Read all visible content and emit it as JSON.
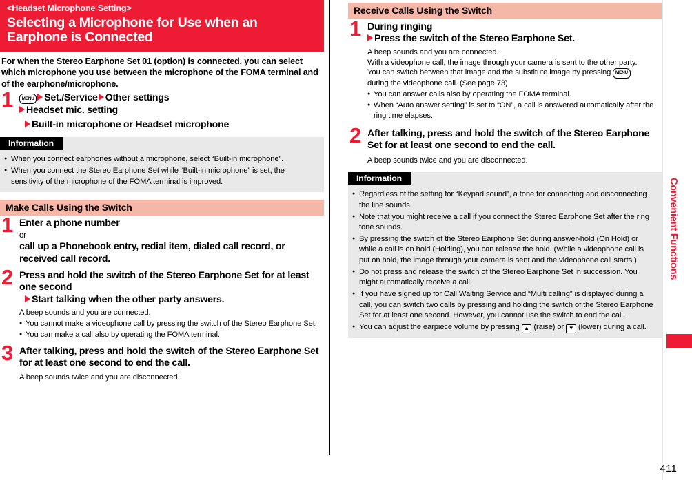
{
  "page": {
    "number": "411",
    "side_label": "Convenient Functions"
  },
  "title": {
    "kicker": "<Headset Microphone Setting>",
    "main": "Selecting a Microphone for Use when an Earphone is Connected",
    "bg_color": "#ed1b34"
  },
  "left": {
    "intro": "For when the Stereo Earphone Set 01 (option) is connected, you can select which microphone you use between the microphone of the FOMA terminal and of the earphone/microphone.",
    "step1": {
      "num": "1",
      "key": "MENU",
      "line1_a": "Set./Service",
      "line1_b": "Other settings",
      "line2": "Headset mic. setting",
      "line3": "Built-in microphone or Headset microphone"
    },
    "info": {
      "title": "Information",
      "items": [
        "When you connect earphones without a microphone, select “Built-in microphone”.",
        "When you connect the Stereo Earphone Set while “Built-in microphone” is set, the sensitivity of the microphone of the FOMA terminal is improved."
      ]
    },
    "section": {
      "heading": "Make Calls Using the Switch",
      "bg_color": "#f5b7a8"
    },
    "step_make_1": {
      "num": "1",
      "head_line1": "Enter a phone number",
      "head_or": "or",
      "head_line2": "call up a Phonebook entry, redial item, dialed call record, or received call record."
    },
    "step_make_2": {
      "num": "2",
      "head_line1": "Press and hold the switch of the Stereo Earphone Set for at least one second",
      "head_line2": "Start talking when the other party answers.",
      "body_lead": "A beep sounds and you are connected.",
      "bullets": [
        "You cannot make a videophone call by pressing the switch of the Stereo Earphone Set.",
        "You can make a call also by operating the FOMA terminal."
      ]
    },
    "step_make_3": {
      "num": "3",
      "head": "After talking, press and hold the switch of the Stereo Earphone Set for at least one second to end the call.",
      "body": "A beep sounds twice and you are disconnected."
    }
  },
  "right": {
    "section": {
      "heading": "Receive Calls Using the Switch",
      "bg_color": "#f5b7a8"
    },
    "step_recv_1": {
      "num": "1",
      "head_line1": "During ringing",
      "head_line2": "Press the switch of the Stereo Earphone Set.",
      "body_l1": "A beep sounds and you are connected.",
      "body_l2": "With a videophone call, the image through your camera is sent to the other party.",
      "body_l3_a": "You can switch between that image and the substitute image by pressing",
      "body_l3_key": "MENU",
      "body_l4": "during the videophone call. (See page 73)",
      "bullets": [
        "You can answer calls also by operating the FOMA terminal.",
        "When “Auto answer setting” is set to “ON”, a call is answered automatically after the ring time elapses."
      ]
    },
    "step_recv_2": {
      "num": "2",
      "head": "After talking, press and hold the switch of the Stereo Earphone Set for at least one second to end the call.",
      "body": "A beep sounds twice and you are disconnected."
    },
    "info": {
      "title": "Information",
      "items": [
        "Regardless of the setting for “Keypad sound”, a tone for connecting and disconnecting the line sounds.",
        "Note that you might receive a call if you connect the Stereo Earphone Set after the ring tone sounds.",
        "By pressing the switch of the Stereo Earphone Set during answer-hold (On Hold) or while a call is on hold (Holding), you can release the hold. (While a videophone call is put on hold, the image through your camera is sent and the videophone call starts.)",
        "Do not press and release the switch of the Stereo Earphone Set in succession. You might automatically receive a call.",
        "If you have signed up for Call Waiting Service and “Multi calling” is displayed during a call, you can switch two calls by pressing and holding the switch of the Stereo Earphone Set for at least one second. However, you cannot use the switch to end the call."
      ],
      "volume_item": {
        "a": "You can adjust the earpiece volume by pressing",
        "key_up": "▲",
        "b": "(raise) or",
        "key_down": "▼",
        "c": "(lower) during a call."
      }
    }
  }
}
